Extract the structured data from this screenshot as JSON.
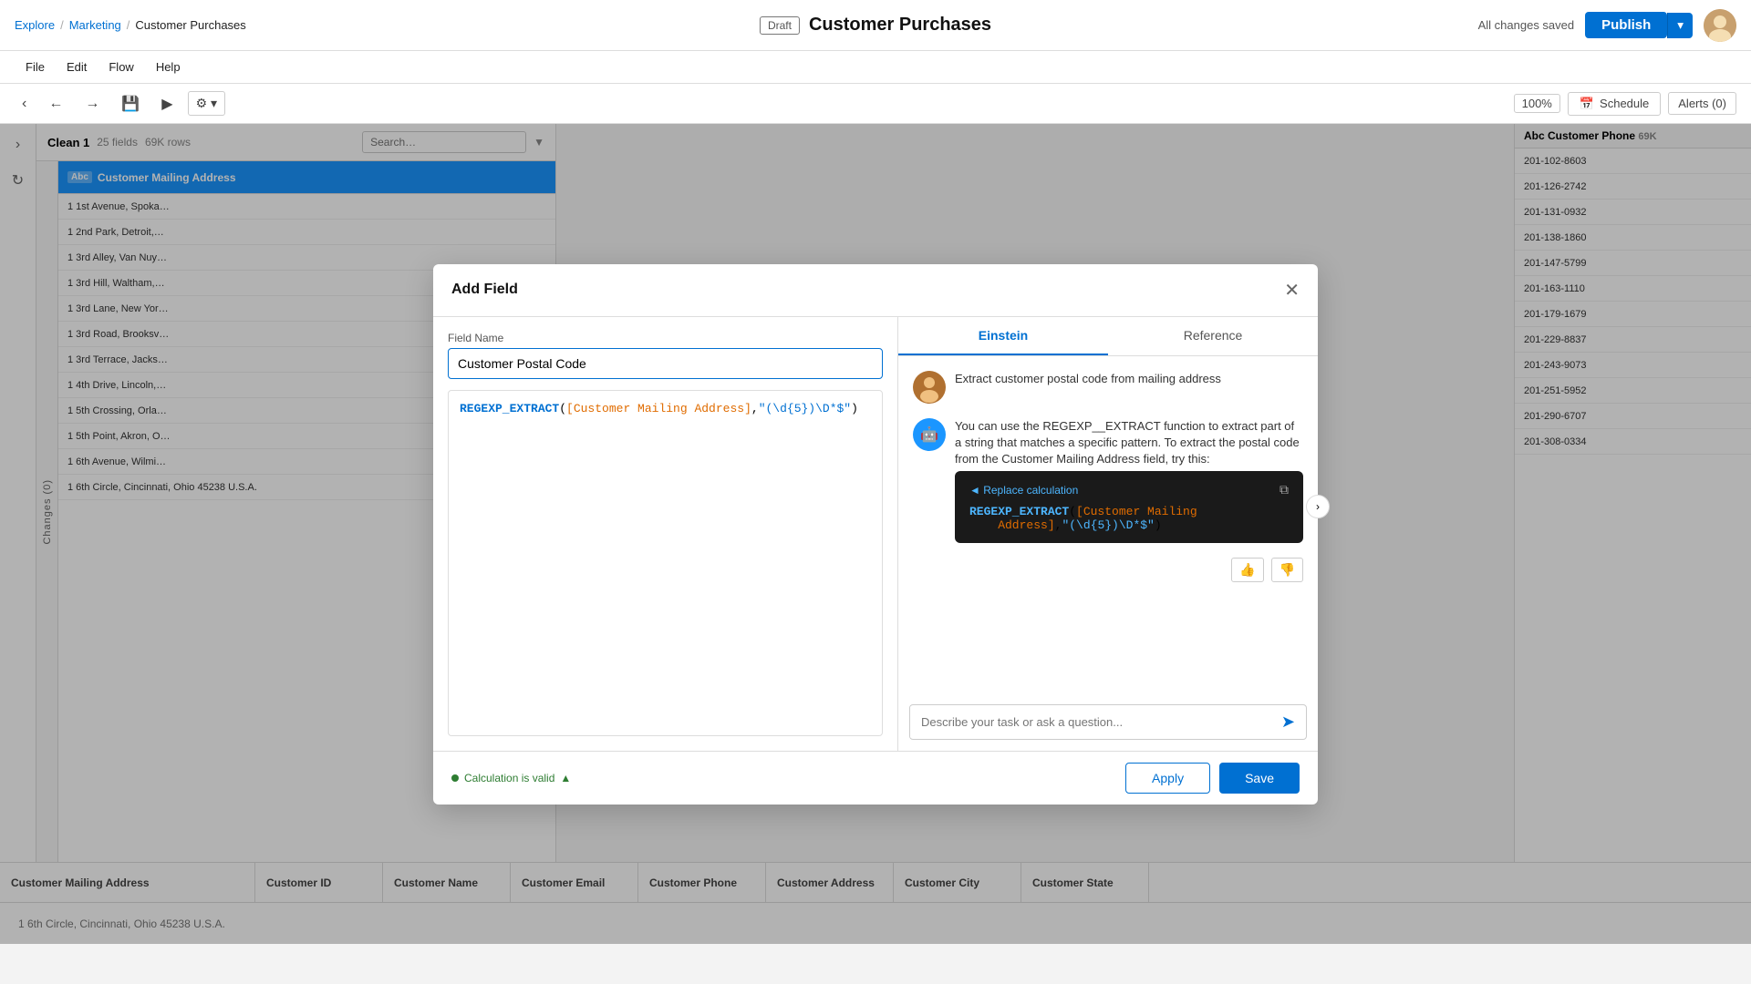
{
  "app": {
    "breadcrumb": {
      "explore": "Explore",
      "marketing": "Marketing",
      "current": "Customer Purchases",
      "sep1": "/",
      "sep2": "/"
    },
    "title": "Customer Purchases",
    "draft_label": "Draft",
    "saved_label": "All changes saved",
    "publish_label": "Publish"
  },
  "menu": {
    "file": "File",
    "edit": "Edit",
    "flow": "Flow",
    "help": "Help"
  },
  "toolbar": {
    "back_icon": "←",
    "forward_icon": "→",
    "save_icon": "💾",
    "play_icon": "▶",
    "settings_icon": "⚙",
    "zoom_label": "100%",
    "schedule_label": "Schedule",
    "alerts_label": "Alerts (0)"
  },
  "clean_panel": {
    "title": "Clean 1",
    "fields": "25 fields",
    "rows": "69K rows",
    "column_name": "Customer Mailing Address",
    "column_type": "Abc",
    "cells": [
      "1 1st Avenue, Spoka…",
      "1 2nd Park, Detroit,…",
      "1 3rd Alley, Van Nuy…",
      "1 3rd Hill, Waltham,…",
      "1 3rd Lane, New Yor…",
      "1 3rd Road, Brooksv…",
      "1 3rd Terrace, Jacks…",
      "1 4th Drive, Lincoln,…",
      "1 5th Crossing, Orla…",
      "1 5th Point, Akron, O…",
      "1 6th Avenue, Wilmi…",
      "1 6th Circle, Cincinnati, Ohio 45238 U.S.A."
    ]
  },
  "right_panel": {
    "column_name": "Customer Phone",
    "count": "69K",
    "type": "Abc",
    "cells": [
      "201-102-8603",
      "201-126-2742",
      "201-131-0932",
      "201-138-1860",
      "201-147-5799",
      "201-163-1110",
      "201-179-1679",
      "201-229-8837",
      "201-243-9073",
      "201-251-5952",
      "201-290-6707",
      "201-308-0334"
    ]
  },
  "bottom_table": {
    "columns": [
      {
        "name": "Customer Mailing Address",
        "width": "wide"
      },
      {
        "name": "Customer ID",
        "width": "medium"
      },
      {
        "name": "Customer Name",
        "width": "medium"
      },
      {
        "name": "Customer Email",
        "width": "medium"
      },
      {
        "name": "Customer Phone",
        "width": "medium"
      },
      {
        "name": "Customer Address",
        "width": "medium"
      },
      {
        "name": "Customer City",
        "width": "medium"
      },
      {
        "name": "Customer State",
        "width": "medium"
      }
    ]
  },
  "modal": {
    "title": "Add Field",
    "field_name_label": "Field Name",
    "field_name_value": "Customer Postal Code",
    "tab_einstein": "Einstein",
    "tab_reference": "Reference",
    "code_text": "REGEXP_EXTRACT([Customer Mailing Address],(\\d{5})\\D*$)",
    "calc_valid_label": "Calculation is valid",
    "suggestion_text": "Extract customer postal code from mailing address",
    "einstein_explanation": "You can use the REGEXP__EXTRACT function to extract part of a string that matches a specific pattern. To extract the postal code from the Customer Mailing Address field, try this:",
    "replace_calc_label": "◄ Replace calculation",
    "code_suggestion": "REGEXP_EXTRACT([Customer Mailing Address],(\\d{5})\\D*$)",
    "ask_placeholder": "Describe your task or ask a question...",
    "apply_label": "Apply",
    "save_label": "Save"
  }
}
